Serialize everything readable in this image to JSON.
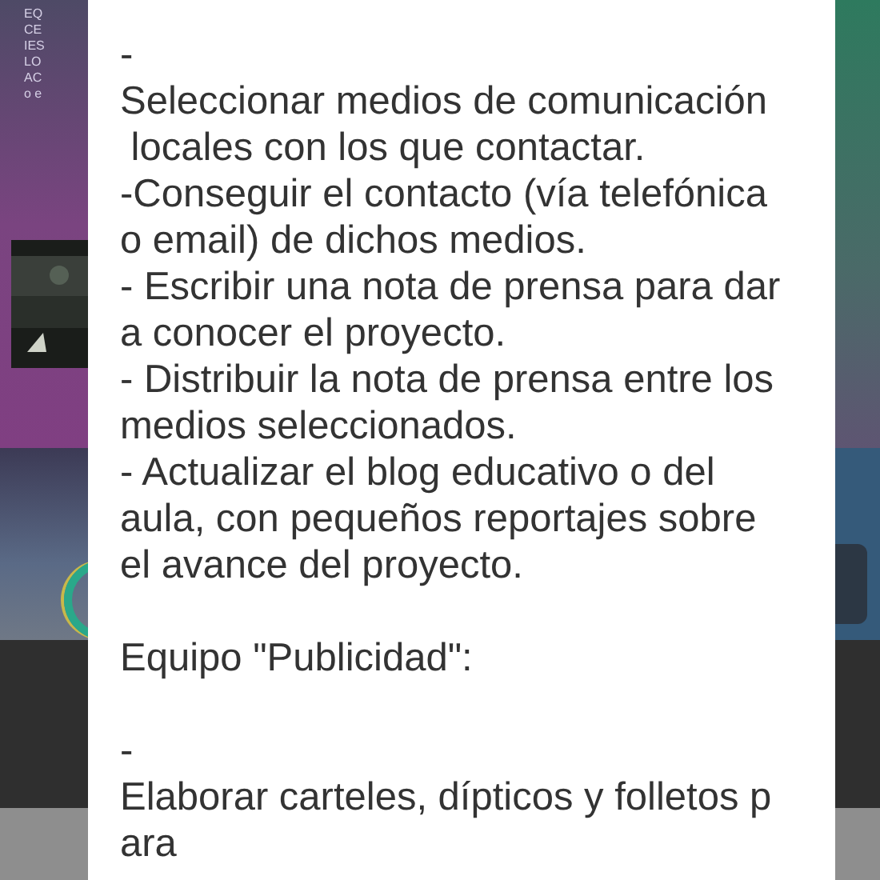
{
  "background_text": [
    "EQ",
    "CE",
    "IES",
    "LO",
    "AC",
    "o e"
  ],
  "dialog": {
    "paragraphs": [
      {
        "lines": [
          "-",
          "Seleccionar medios de comunicación",
          " locales con los que contactar.",
          "-Conseguir el contacto (vía telefónica",
          "o email) de dichos medios.",
          "- Escribir una nota de prensa para dar",
          "a conocer el proyecto.",
          "- Distribuir la nota de prensa entre los",
          "medios seleccionados.",
          "- Actualizar el blog educativo o del",
          "aula, con pequeños reportajes sobre",
          "el avance del proyecto."
        ]
      },
      {
        "lines": [
          "Equipo \"Publicidad\":"
        ]
      },
      {
        "lines": [
          "-",
          "Elaborar carteles, dípticos y folletos p",
          "ara"
        ]
      }
    ]
  }
}
